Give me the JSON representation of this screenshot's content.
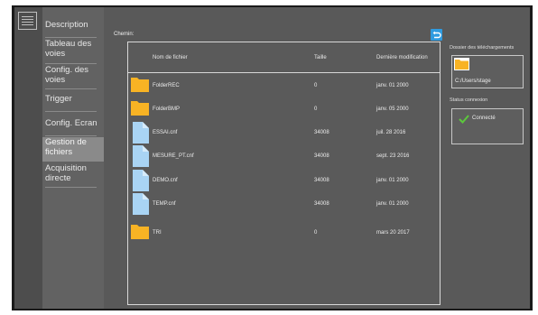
{
  "sidebar": {
    "items": [
      {
        "label": "Description"
      },
      {
        "label": "Tableau des voies"
      },
      {
        "label": "Config. des voies"
      },
      {
        "label": "Trigger"
      },
      {
        "label": "Config. Ecran"
      },
      {
        "label": "Gestion de fichiers"
      },
      {
        "label": "Acquisition directe"
      }
    ]
  },
  "main": {
    "path_label": "Chemin:",
    "table": {
      "headers": {
        "name": "Nom de fichier",
        "size": "Taille",
        "modified": "Dernière modification"
      },
      "rows": [
        {
          "type": "folder",
          "name": "FolderREC",
          "size": "0",
          "modified": "janv. 01 2000"
        },
        {
          "type": "folder",
          "name": "FolderBMP",
          "size": "0",
          "modified": "janv. 05 2000"
        },
        {
          "type": "file",
          "name": "ESSAI.cnf",
          "size": "34008",
          "modified": "juil. 28 2016"
        },
        {
          "type": "file",
          "name": "MESURE_PT.cnf",
          "size": "34008",
          "modified": "sept. 23 2016"
        },
        {
          "type": "file",
          "name": "DEMO.cnf",
          "size": "34008",
          "modified": "janv. 01 2000"
        },
        {
          "type": "file",
          "name": "TEMP.cnf",
          "size": "34008",
          "modified": "janv. 01 2000"
        },
        {
          "type": "folder",
          "name": "TRI",
          "size": "0",
          "modified": "mars 20 2017"
        }
      ]
    }
  },
  "right_panel": {
    "download_label": "Dossier des téléchargements",
    "download_path": "C:/Users/stage",
    "status_label": "Status connexion",
    "status_text": "Connecté"
  },
  "colors": {
    "folder": "#f8b324",
    "file": "#a9d4f4",
    "check": "#5cc83c",
    "refresh": "#2f9be0"
  }
}
